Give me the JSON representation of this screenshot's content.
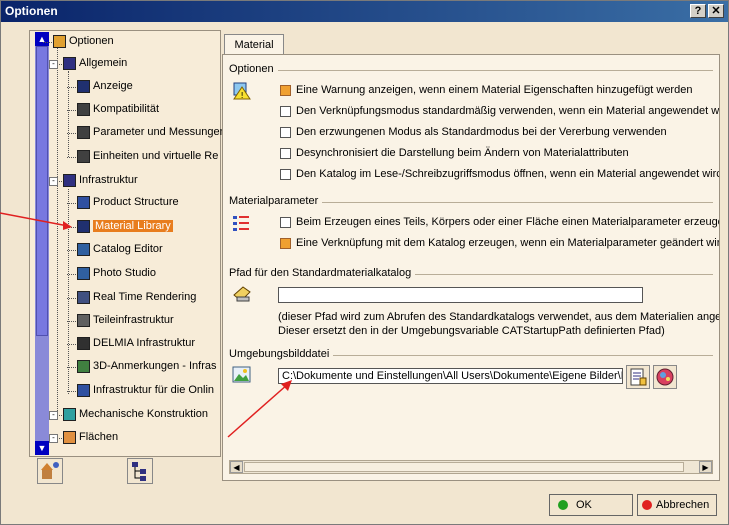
{
  "window": {
    "title": "Optionen",
    "help_label": "?",
    "close_label": "✕"
  },
  "tree": {
    "items": [
      {
        "label": "Optionen",
        "icon": "options-root-icon"
      },
      {
        "label": "Allgemein",
        "icon": "general-icon"
      },
      {
        "label": "Anzeige",
        "icon": "display-icon"
      },
      {
        "label": "Kompatibilität",
        "icon": "compatibility-icon"
      },
      {
        "label": "Parameter und Messungen",
        "icon": "parameters-icon"
      },
      {
        "label": "Einheiten und virtuelle Re",
        "icon": "units-icon"
      },
      {
        "label": "Infrastruktur",
        "icon": "infrastructure-icon"
      },
      {
        "label": "Product Structure",
        "icon": "product-structure-icon"
      },
      {
        "label": "Material Library",
        "icon": "material-library-icon"
      },
      {
        "label": "Catalog Editor",
        "icon": "catalog-editor-icon"
      },
      {
        "label": "Photo Studio",
        "icon": "photo-studio-icon"
      },
      {
        "label": "Real Time Rendering",
        "icon": "rendering-icon"
      },
      {
        "label": "Teileinfrastruktur",
        "icon": "part-infrastructure-icon"
      },
      {
        "label": "DELMIA Infrastruktur",
        "icon": "delmia-icon"
      },
      {
        "label": "3D-Anmerkungen - Infras",
        "icon": "annotations-icon"
      },
      {
        "label": "Infrastruktur für die Onlin",
        "icon": "online-infrastructure-icon"
      },
      {
        "label": "Mechanische Konstruktion",
        "icon": "mechanical-design-icon"
      },
      {
        "label": "Flächen",
        "icon": "surfaces-icon"
      }
    ]
  },
  "tab": {
    "label": "Material"
  },
  "groups": {
    "optionen": {
      "title": "Optionen",
      "options": [
        {
          "label": "Eine Warnung anzeigen, wenn einem Material Eigenschaften hinzugefügt werden",
          "checked": true
        },
        {
          "label": "Den Verknüpfungsmodus standardmäßig verwenden, wenn ein Material angewendet wi",
          "checked": false
        },
        {
          "label": "Den erzwungenen Modus als Standardmodus bei der Vererbung verwenden",
          "checked": false
        },
        {
          "label": "Desynchronisiert die Darstellung beim Ändern von Materialattributen",
          "checked": false
        },
        {
          "label": "Den Katalog im Lese-/Schreibzugriffsmodus öffnen, wenn ein Material angewendet wirc",
          "checked": false
        }
      ]
    },
    "materialparameter": {
      "title": "Materialparameter",
      "options": [
        {
          "label": "Beim Erzeugen eines Teils, Körpers oder einer Fläche einen Materialparameter erzeuger",
          "checked": false
        },
        {
          "label": "Eine Verknüpfung mit dem Katalog erzeugen, wenn ein Materialparameter geändert wir",
          "checked": true
        }
      ]
    },
    "pfad": {
      "title": "Pfad für den Standardmaterialkatalog",
      "value": "",
      "note_line1": "(dieser Pfad wird zum Abrufen des Standardkatalogs verwendet, aus dem Materialien ange",
      "note_line2": "Dieser ersetzt den in der Umgebungsvariable CATStartupPath definierten Pfad)"
    },
    "umgebung": {
      "title": "Umgebungsbilddatei",
      "value": "C:\\Dokumente und Einstellungen\\All Users\\Dokumente\\Eigene Bilder\\Ba"
    }
  },
  "buttons": {
    "ok": "OK",
    "cancel": "Abbrechen"
  },
  "colors": {
    "selection": "#e87d1e",
    "annotation_arrow": "#e02020",
    "title_bar": "#0a246a"
  }
}
